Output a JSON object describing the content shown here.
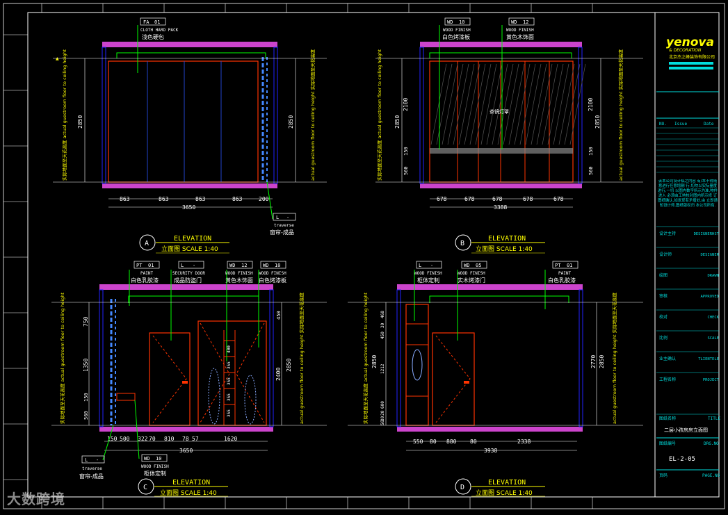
{
  "colors": {
    "bg": "#000000",
    "frame": "#ffffff",
    "wall": "#2222ff",
    "ceiling": "#cc44cc",
    "dim": "#ffff00",
    "tag": "#00ff00",
    "furn": "#ff3300",
    "glass": "#4488ff",
    "cyan": "#00dddd"
  },
  "watermark": "大数跨境",
  "elevA": {
    "tags": [
      {
        "code": "FA",
        "num": "01",
        "en": "CLOTH HARD PACK",
        "cn": "浅色硬包"
      }
    ],
    "left_vtext": "实际地面至天花高度 actual guestroom floor to ceiling height",
    "right_vtext": "actual guestroom floor to ceiling height 实际地面至天花高度",
    "vdims": [
      "2850",
      "2850"
    ],
    "hdims": [
      "863",
      "863",
      "863",
      "863",
      "200"
    ],
    "total": "3650",
    "curtain_tag": {
      "code": "L",
      "num": "-",
      "en": "traverse",
      "cn": "窗帘-成品"
    },
    "badge": "A",
    "title": "ELEVATION",
    "sub": "立面图  SCALE 1:40"
  },
  "elevB": {
    "tags": [
      {
        "code": "WD",
        "num": "10",
        "en": "WOOD FINISH",
        "cn": "白色烤漆板"
      },
      {
        "code": "WD",
        "num": "12",
        "en": "WOOD FINISH",
        "cn": "黄色木饰面"
      }
    ],
    "mirror": "茶镜灯罩",
    "left_vtext": "实际地面至天花高度 actual guestroom floor to ceiling height",
    "right_vtext": "actual guestroom floor to ceiling height 实际地面至天花高度",
    "vdims_left": [
      "2100",
      "150",
      "560",
      "2850"
    ],
    "vdims_right": [
      "2100",
      "150",
      "560",
      "2850"
    ],
    "hdims": [
      "678",
      "678",
      "678",
      "678",
      "678"
    ],
    "total": "3388",
    "badge": "B",
    "title": "ELEVATION",
    "sub": "立面图  SCALE 1:40"
  },
  "elevC": {
    "tags": [
      {
        "code": "PT",
        "num": "01",
        "en": "PAINT",
        "cn": "白色乳胶漆"
      },
      {
        "code": "L",
        "num": "-",
        "en": "SECURITY DOOR",
        "cn": "成品防盗门"
      },
      {
        "code": "WD",
        "num": "12",
        "en": "WOOD FINISH",
        "cn": "黄色木饰面"
      },
      {
        "code": "WD",
        "num": "10",
        "en": "WOOD FINISH",
        "cn": "白色烤漆板"
      }
    ],
    "vdims_left": [
      "750",
      "1350",
      "150",
      "560"
    ],
    "vdims_mid": [
      "400",
      "355",
      "355",
      "355",
      "355"
    ],
    "vdims_right": [
      "450",
      "2400",
      "2850"
    ],
    "hdims": [
      "150",
      "500",
      "322",
      "70",
      "810",
      "78",
      "57",
      "1620"
    ],
    "total": "3650",
    "bottom_tags": [
      {
        "code": "L",
        "num": "-",
        "en": "traverse",
        "cn": "窗帘-成品"
      },
      {
        "code": "WD",
        "num": "10",
        "en": "WOOD FINISH",
        "cn": "柜体定制"
      }
    ],
    "badge": "C",
    "title": "ELEVATION",
    "sub": "立面图  SCALE 1:40"
  },
  "elevD": {
    "tags": [
      {
        "code": "L",
        "num": "-",
        "en": "WOOD FINISH",
        "cn": "柜体定制"
      },
      {
        "code": "WD",
        "num": "05",
        "en": "WOOD FINISH",
        "cn": "实木烤漆门"
      },
      {
        "code": "PT",
        "num": "01",
        "en": "PAINT",
        "cn": "白色乳胶漆"
      }
    ],
    "vdims_left": [
      "468",
      "30",
      "450",
      "1212",
      "600",
      "20",
      "30",
      "50",
      "2850"
    ],
    "vdims_right": [
      "2770",
      "2850"
    ],
    "hdims": [
      "550",
      "80",
      "880",
      "80",
      "2338"
    ],
    "total": "3938",
    "badge": "D",
    "title": "ELEVATION",
    "sub": "立面图  SCALE 1:40"
  },
  "titleblock": {
    "logo": "yenova",
    "logo2": "& DECORATION",
    "logo3": "北京杰之峰装饰有限公司",
    "no": "NO.",
    "issue": "Issue",
    "date": "Date",
    "note": "该本公司设计稿之内容 有/本不得随意进行任意增删 行,切勿以实际量度进行,一切 以图内数字所示为准,物件进入 必须由工地核对图内所示修 订图纸确认,如发现有矛盾处,由 立即通知设计师,图纸版权归 本公司所有.",
    "rows": [
      {
        "cn": "设计主持",
        "en": "DESIGNERHST"
      },
      {
        "cn": "设计师",
        "en": "DESIGNER"
      },
      {
        "cn": "绘图",
        "en": "DRAWN"
      },
      {
        "cn": "审核",
        "en": "APPROVED"
      },
      {
        "cn": "校对",
        "en": "CHECK"
      },
      {
        "cn": "比例",
        "en": "SCALE"
      },
      {
        "cn": "业主确认",
        "en": "TLIENTELE"
      },
      {
        "cn": "工程名称",
        "en": "PROJECT"
      }
    ],
    "title_cn": "图纸名称",
    "title_en": "TITLE",
    "title_val": "二层小孩房房立面图",
    "dno_cn": "图纸编号",
    "dno_en": "DRG.NO",
    "dno_val": "EL-2-05",
    "page_cn": "页码",
    "page_en": "PAGE.NO"
  }
}
